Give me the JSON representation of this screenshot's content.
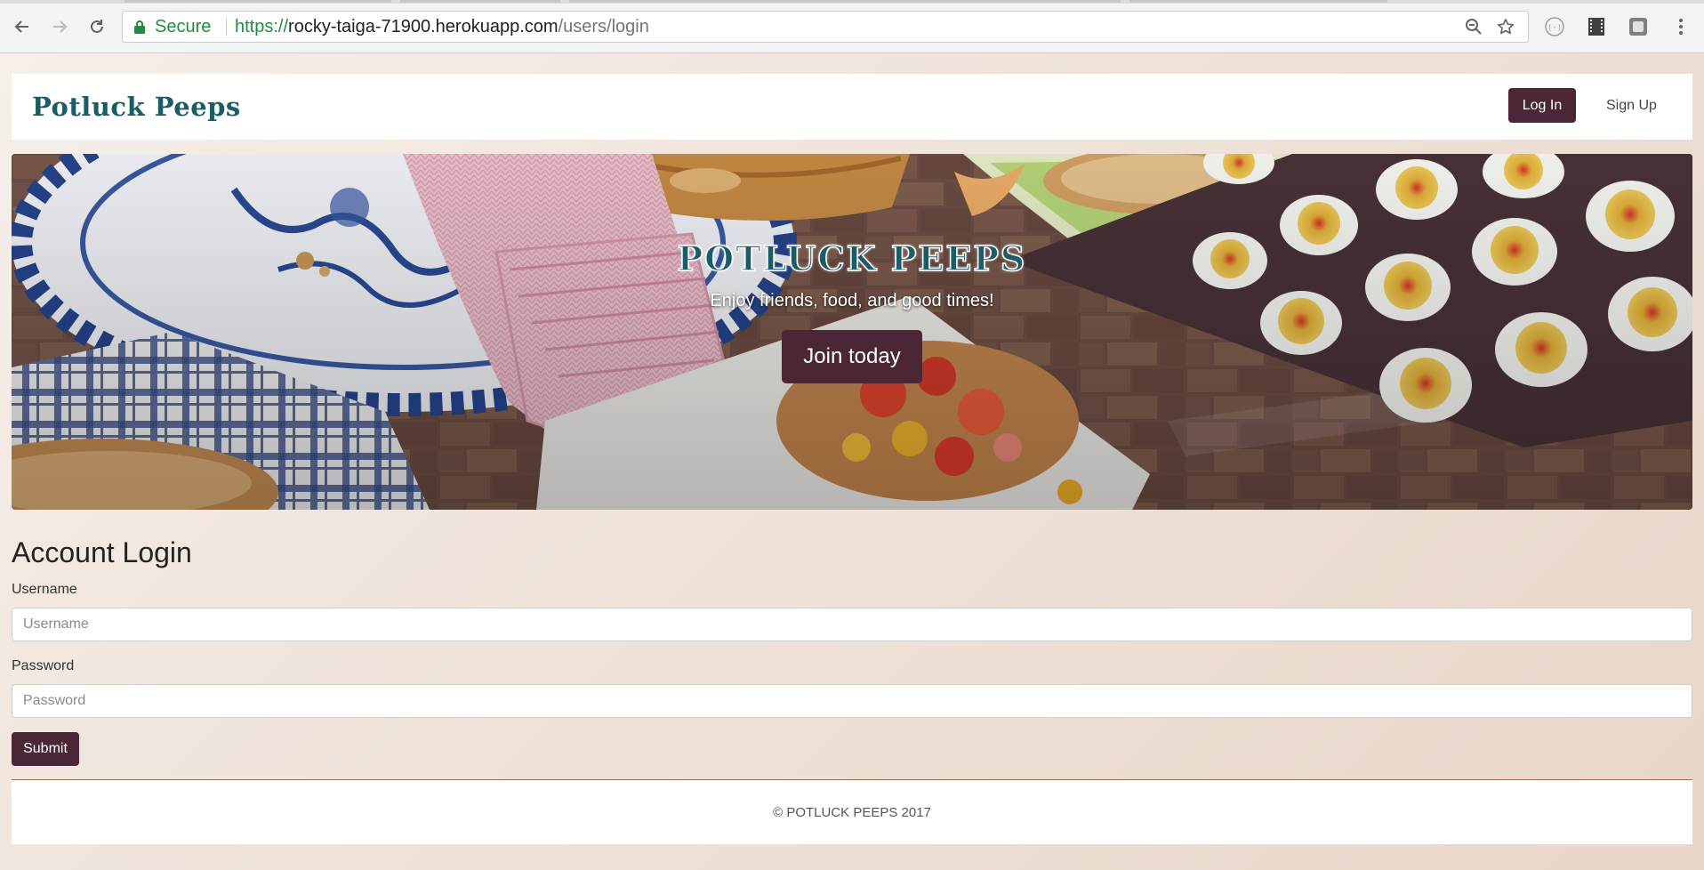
{
  "browser": {
    "secure_label": "Secure",
    "url_scheme": "https://",
    "url_host": "rocky-taiga-71900.herokuapp.com",
    "url_path": "/users/login"
  },
  "nav": {
    "brand": "Potluck Peeps",
    "login_label": "Log In",
    "signup_label": "Sign Up"
  },
  "hero": {
    "title": "POTLUCK PEEPS",
    "subtitle": "Enjoy friends, food, and good times!",
    "cta_label": "Join today"
  },
  "login_form": {
    "title": "Account Login",
    "username_label": "Username",
    "username_placeholder": "Username",
    "username_value": "",
    "password_label": "Password",
    "password_placeholder": "Password",
    "password_value": "",
    "submit_label": "Submit"
  },
  "footer": {
    "text": "© POTLUCK PEEPS 2017"
  },
  "colors": {
    "brand_teal": "#1b5c66",
    "primary_button": "#4a2637",
    "secure_green": "#1e8e3e"
  }
}
